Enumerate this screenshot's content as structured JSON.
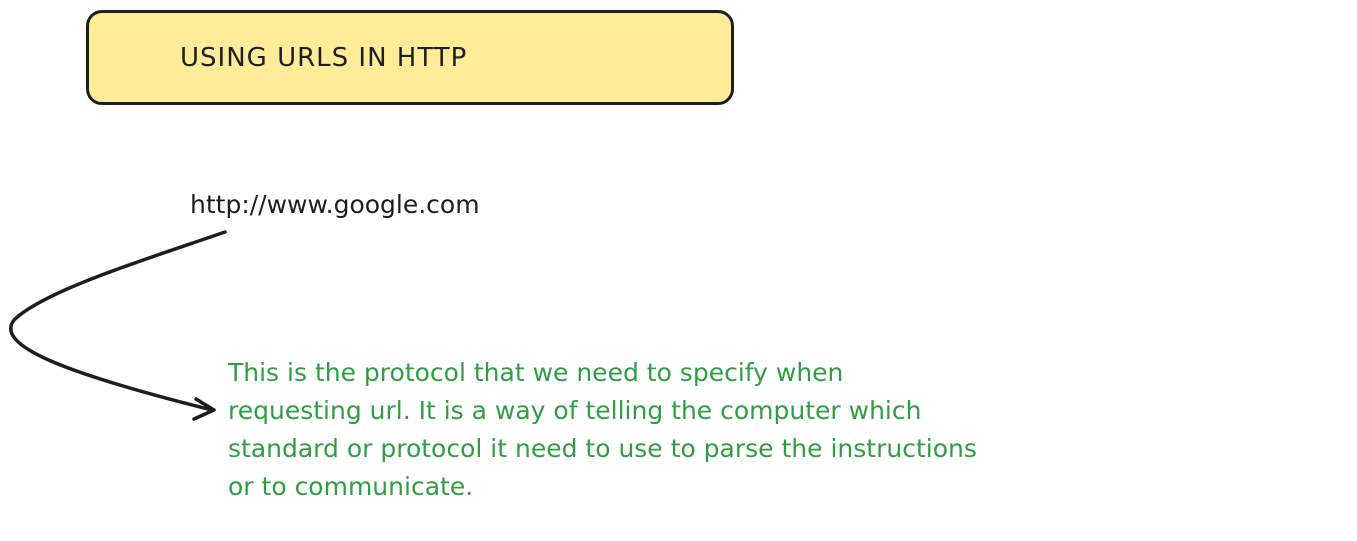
{
  "title": "USING URLS IN HTTP",
  "url": "http://www.google.com",
  "annotation": {
    "lines": [
      "This is the protocol that we need to specify when",
      "requesting url. It is a way of telling the computer which",
      "standard or protocol it need to use to parse the instructions",
      "or to communicate."
    ],
    "color": "#2f9e44"
  },
  "colors": {
    "title_fill": "#ffec99",
    "stroke": "#1e1e1e"
  }
}
